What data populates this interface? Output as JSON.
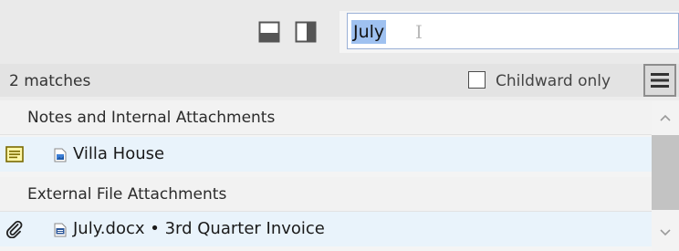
{
  "toolbar": {
    "layout_bottom_icon": "layout-bottom-pane-icon",
    "layout_right_icon": "layout-right-pane-icon"
  },
  "search": {
    "value": "July"
  },
  "status": {
    "matches": "2 matches",
    "childward_label": "Childward only",
    "childward_checked": false
  },
  "results": {
    "groups": [
      {
        "title": "Notes and Internal Attachments",
        "items": [
          {
            "label": "Villa House",
            "icons": [
              "note-icon",
              "image-attachment-icon"
            ]
          }
        ]
      },
      {
        "title": "External File Attachments",
        "items": [
          {
            "label": "July.docx • 3rd Quarter Invoice",
            "icons": [
              "paperclip-icon",
              "word-document-icon"
            ]
          }
        ]
      }
    ]
  },
  "colors": {
    "selection_highlight": "#9fc1f0",
    "item_row_background": "#e9f3fb",
    "scroll_thumb": "#c3c3c3"
  }
}
